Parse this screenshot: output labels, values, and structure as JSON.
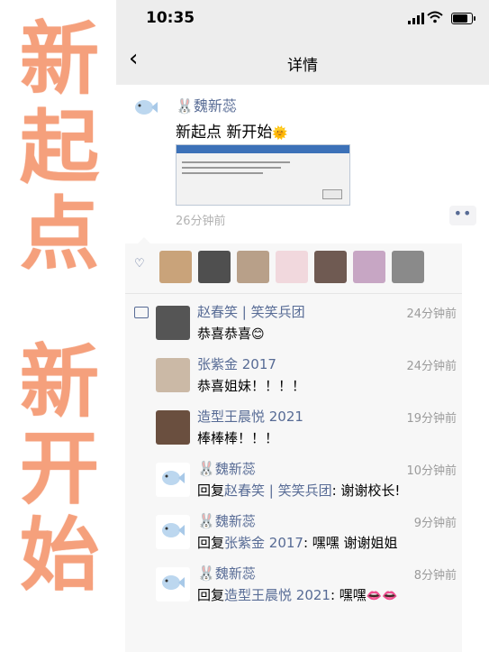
{
  "overlay_title": [
    "新",
    "起",
    "点",
    "新",
    "开",
    "始"
  ],
  "status_bar": {
    "time": "10:35"
  },
  "nav": {
    "title": "详情"
  },
  "post": {
    "author": "魏新蕊",
    "author_emoji": "🐰",
    "text": "新起点  新开始",
    "text_emoji": "🌞",
    "time": "26分钟前",
    "more_label": "••"
  },
  "likes": {
    "avatar_colors": [
      "#c9a37a",
      "#4f4f4f",
      "#b8a089",
      "#f1d8dd",
      "#6f5a52",
      "#c7a6c4",
      "#8a8a8a"
    ]
  },
  "comments": [
    {
      "name": "赵春笑 | 笑笑兵团",
      "time": "24分钟前",
      "text": "恭喜恭喜",
      "emoji": "😊"
    },
    {
      "name": "张紫金 2017",
      "time": "24分钟前",
      "text": "恭喜姐妹！！！！",
      "emoji": ""
    },
    {
      "name": "造型王晨悦 2021",
      "time": "19分钟前",
      "text": "棒棒棒！！！",
      "emoji": ""
    },
    {
      "name": "魏新蕊",
      "time": "10分钟前",
      "reply_prefix": "回复",
      "reply_to": "赵春笑 | 笑笑兵团",
      "text": ": 谢谢校长!",
      "emoji": ""
    },
    {
      "name": "魏新蕊",
      "time": "9分钟前",
      "reply_prefix": "回复",
      "reply_to": "张紫金 2017",
      "text": ": 嘿嘿  谢谢姐姐",
      "emoji": ""
    },
    {
      "name": "魏新蕊",
      "time": "8分钟前",
      "reply_prefix": "回复",
      "reply_to": "造型王晨悦 2021",
      "text": ": 嘿嘿",
      "emoji": "👄👄"
    }
  ],
  "colors": {
    "link": "#576b95",
    "overlay": "#f5a07c"
  }
}
